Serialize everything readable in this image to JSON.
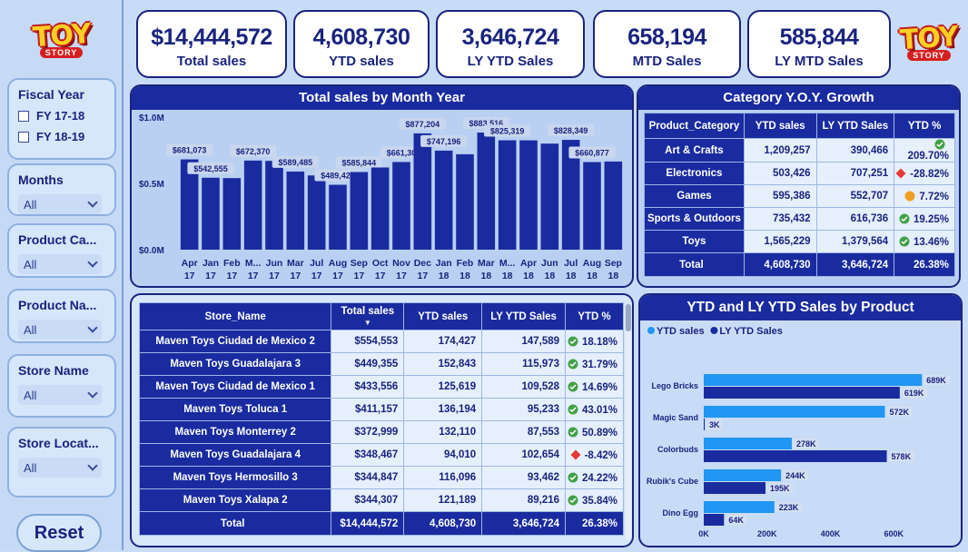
{
  "logo": {
    "line1": "TOY",
    "line2": "STORY"
  },
  "filters": {
    "fiscal_year": {
      "title": "Fiscal Year",
      "options": [
        "FY 17-18",
        "FY 18-19"
      ]
    },
    "months": {
      "title": "Months",
      "value": "All"
    },
    "product_category": {
      "title": "Product Ca...",
      "value": "All"
    },
    "product_name": {
      "title": "Product Na...",
      "value": "All"
    },
    "store_name": {
      "title": "Store Name",
      "value": "All"
    },
    "store_location": {
      "title": "Store Locat...",
      "value": "All"
    }
  },
  "reset_label": "Reset",
  "kpis": [
    {
      "value": "$14,444,572",
      "label": "Total sales"
    },
    {
      "value": "4,608,730",
      "label": "YTD sales"
    },
    {
      "value": "3,646,724",
      "label": "LY YTD Sales"
    },
    {
      "value": "658,194",
      "label": "MTD Sales"
    },
    {
      "value": "585,844",
      "label": "LY MTD Sales"
    }
  ],
  "monthly_panel_title": "Total sales by Month Year",
  "category_panel_title": "Category Y.O.Y. Growth",
  "category_table": {
    "headers": [
      "Product_Category",
      "YTD sales",
      "LY YTD Sales",
      "YTD %"
    ],
    "rows": [
      {
        "name": "Art & Crafts",
        "ytd": "1,209,257",
        "ly": "390,466",
        "pct": "209.70%",
        "status": "good"
      },
      {
        "name": "Electronics",
        "ytd": "503,426",
        "ly": "707,251",
        "pct": "-28.82%",
        "status": "bad"
      },
      {
        "name": "Games",
        "ytd": "595,386",
        "ly": "552,707",
        "pct": "7.72%",
        "status": "warn"
      },
      {
        "name": "Sports & Outdoors",
        "ytd": "735,432",
        "ly": "616,736",
        "pct": "19.25%",
        "status": "good"
      },
      {
        "name": "Toys",
        "ytd": "1,565,229",
        "ly": "1,379,564",
        "pct": "13.46%",
        "status": "good"
      }
    ],
    "total": {
      "name": "Total",
      "ytd": "4,608,730",
      "ly": "3,646,724",
      "pct": "26.38%"
    }
  },
  "store_table": {
    "headers": [
      "Store_Name",
      "Total sales",
      "YTD sales",
      "LY YTD Sales",
      "YTD %"
    ],
    "rows": [
      {
        "name": "Maven Toys Ciudad de Mexico 2",
        "total": "$554,553",
        "ytd": "174,427",
        "ly": "147,589",
        "pct": "18.18%",
        "status": "good"
      },
      {
        "name": "Maven Toys Guadalajara 3",
        "total": "$449,355",
        "ytd": "152,843",
        "ly": "115,973",
        "pct": "31.79%",
        "status": "good"
      },
      {
        "name": "Maven Toys Ciudad de Mexico 1",
        "total": "$433,556",
        "ytd": "125,619",
        "ly": "109,528",
        "pct": "14.69%",
        "status": "good"
      },
      {
        "name": "Maven Toys Toluca 1",
        "total": "$411,157",
        "ytd": "136,194",
        "ly": "95,233",
        "pct": "43.01%",
        "status": "good"
      },
      {
        "name": "Maven Toys Monterrey 2",
        "total": "$372,999",
        "ytd": "132,110",
        "ly": "87,553",
        "pct": "50.89%",
        "status": "good"
      },
      {
        "name": "Maven Toys Guadalajara 4",
        "total": "$348,467",
        "ytd": "94,010",
        "ly": "102,654",
        "pct": "-8.42%",
        "status": "bad"
      },
      {
        "name": "Maven Toys Hermosillo 3",
        "total": "$344,847",
        "ytd": "116,096",
        "ly": "93,462",
        "pct": "24.22%",
        "status": "good"
      },
      {
        "name": "Maven Toys Xalapa 2",
        "total": "$344,307",
        "ytd": "121,189",
        "ly": "89,216",
        "pct": "35.84%",
        "status": "good"
      }
    ],
    "total": {
      "name": "Total",
      "total": "$14,444,572",
      "ytd": "4,608,730",
      "ly": "3,646,724",
      "pct": "26.38%"
    }
  },
  "product_panel_title": "YTD and LY YTD Sales by Product",
  "colors": {
    "navy": "#1a2ba0",
    "light": "#2196f3",
    "good": "#43a047",
    "bad": "#e53935",
    "warn": "#f0a020"
  },
  "chart_data": [
    {
      "type": "bar",
      "title": "Total sales by Month Year",
      "categories": [
        "Apr 17",
        "Jan 17",
        "Feb 17",
        "M... 17",
        "Jun 17",
        "Mar 17",
        "Jul 17",
        "Aug 17",
        "Sep 17",
        "Oct 17",
        "Nov 17",
        "Dec 17",
        "Jan 18",
        "Feb 18",
        "Mar 18",
        "M... 18",
        "Apr 18",
        "Jun 18",
        "Jul 18",
        "Aug 18",
        "Sep 18"
      ],
      "values": [
        681073,
        542555,
        540000,
        672370,
        670000,
        589485,
        560000,
        489420,
        585844,
        620000,
        661300,
        877204,
        747196,
        720000,
        883516,
        825319,
        825000,
        800000,
        828349,
        660877,
        665000
      ],
      "data_labels": [
        "$681,073",
        "$542,555",
        "",
        "$672,370",
        "",
        "$589,485",
        "",
        "$489,420",
        "$585,844",
        "",
        "$661,30",
        "$877,204",
        "$747,196",
        "",
        "$883,516",
        "$825,319",
        "",
        "",
        "$828,349",
        "$660,877",
        ""
      ],
      "ytick_labels": [
        "$1.0M",
        "$0.5M",
        "$0.0M"
      ],
      "ylim": [
        0,
        1000000
      ],
      "series_color": "#1a2ba0"
    },
    {
      "type": "bar",
      "title": "YTD and LY YTD Sales by Product",
      "orientation": "horizontal",
      "categories": [
        "Lego Bricks",
        "Magic Sand",
        "Colorbuds",
        "Rubik's Cube",
        "Dino Egg"
      ],
      "series": [
        {
          "name": "YTD sales",
          "values": [
            689000,
            572000,
            278000,
            244000,
            223000
          ],
          "labels": [
            "689K",
            "572K",
            "278K",
            "244K",
            "223K"
          ],
          "color": "#2196f3"
        },
        {
          "name": "LY YTD Sales",
          "values": [
            619000,
            3000,
            578000,
            195000,
            64000
          ],
          "labels": [
            "619K",
            "3K",
            "578K",
            "195K",
            "64K"
          ],
          "color": "#1a2ba0"
        }
      ],
      "xtick_labels": [
        "0K",
        "200K",
        "400K",
        "600K"
      ],
      "xlim": [
        0,
        780000
      ],
      "legend_position": "top-left"
    }
  ]
}
